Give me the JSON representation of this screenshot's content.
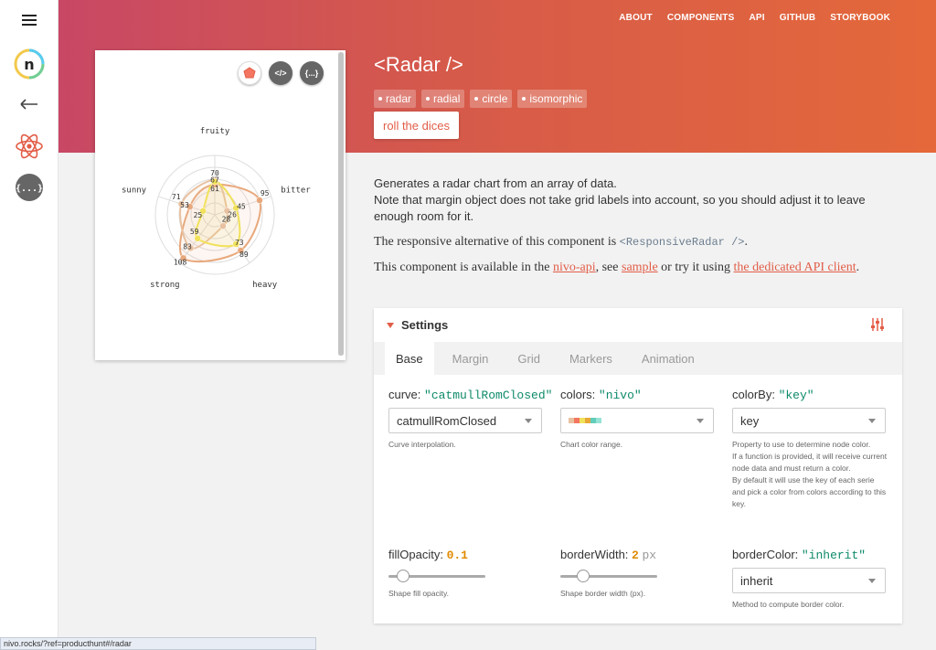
{
  "nav": [
    "ABOUT",
    "COMPONENTS",
    "API",
    "GITHUB",
    "STORYBOOK"
  ],
  "sidebar": {
    "icons": [
      "menu-icon",
      "nivo-logo",
      "back-arrow-icon",
      "react-icon",
      "api-icon"
    ],
    "logo_letter": "n",
    "api_glyph": "{...}"
  },
  "header": {
    "title": "<Radar />",
    "tags": [
      "radar",
      "radial",
      "circle",
      "isomorphic"
    ],
    "dice_label": "roll the dices"
  },
  "chart_card": {
    "icon_labels": [
      "</>",
      "{...}"
    ]
  },
  "chart_data": {
    "type": "radar",
    "axes": [
      "fruity",
      "bitter",
      "heavy",
      "strong",
      "sunny"
    ],
    "series": [
      {
        "values": [
          61,
          95,
          89,
          108,
          53
        ],
        "color": "#e8a87c"
      },
      {
        "values": [
          70,
          26,
          28,
          83,
          71
        ],
        "color": "#e8c1a0"
      },
      {
        "values": [
          67,
          45,
          73,
          59,
          25
        ],
        "color": "#f1e15b"
      }
    ],
    "grid_levels": 5,
    "max": 120,
    "labels": [
      "fruity",
      "bitter",
      "heavy",
      "strong",
      "sunny"
    ],
    "value_labels": [
      "70",
      "67",
      "61",
      "95",
      "45",
      "26",
      "28",
      "73",
      "89",
      "59",
      "83",
      "108",
      "71",
      "53",
      "25"
    ]
  },
  "description": {
    "line1": "Generates a radar chart from an array of data.",
    "line2": "Note that margin object does not take grid labels into account,  so you should adjust it to leave enough room for it.",
    "responsive_prefix": "The responsive alternative of this component is ",
    "responsive_code": "<ResponsiveRadar />",
    "responsive_suffix": ".",
    "api_prefix": "This component is available in the ",
    "api_link": "nivo-api",
    "api_mid": ", see ",
    "sample_link": "sample",
    "api_mid2": " or try it using ",
    "dedicated_link": "the dedicated API client",
    "api_suffix": "."
  },
  "settings": {
    "title": "Settings",
    "tabs": [
      "Base",
      "Margin",
      "Grid",
      "Markers",
      "Animation"
    ],
    "curve": {
      "name": "curve: ",
      "value": "\"catmullRomClosed\"",
      "selected": "catmullRomClosed",
      "help": "Curve interpolation."
    },
    "colors": {
      "name": "colors: ",
      "value": "\"nivo\"",
      "help": "Chart color range.",
      "swatch_colors": [
        "#e8c1a0",
        "#f47560",
        "#f1e15b",
        "#e8a838",
        "#61cdbb",
        "#97e3d5"
      ]
    },
    "colorBy": {
      "name": "colorBy: ",
      "value": "\"key\"",
      "selected": "key",
      "help": "Property to use to determine node color.\nIf a function is provided, it will receive current node data and must return a color.\nBy default it will use the key of each serie and pick a color from colors according to this key."
    },
    "fillOpacity": {
      "name": "fillOpacity: ",
      "value": "0.1",
      "level": 0.1,
      "help": "Shape fill opacity."
    },
    "borderWidth": {
      "name": "borderWidth: ",
      "value": "2",
      "unit": "px",
      "level": 0.2,
      "help": "Shape border width (px)."
    },
    "borderColor": {
      "name": "borderColor: ",
      "value": "\"inherit\"",
      "selected": "inherit",
      "help": "Method to compute border color."
    }
  },
  "status_url": "nivo.rocks/?ref=producthunt#/radar"
}
